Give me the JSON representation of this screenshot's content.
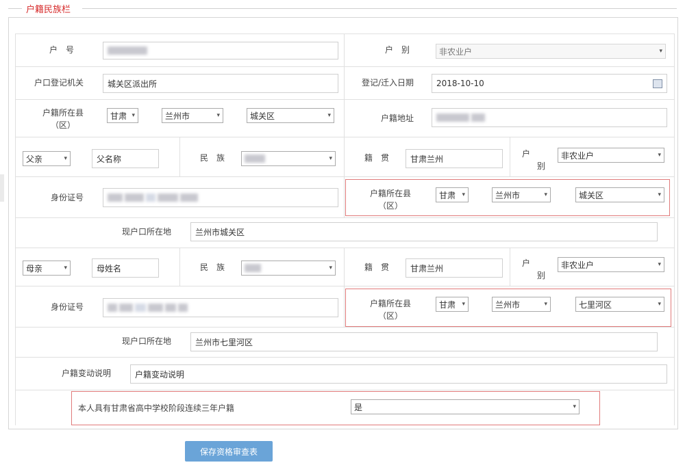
{
  "section": {
    "title": "户籍民族栏"
  },
  "household": {
    "hukou_no_label": "户　号",
    "hukou_no_value": "",
    "hukou_type_label": "户　别",
    "hukou_type_value": "非农业户",
    "reg_office_label": "户口登记机关",
    "reg_office_value": "城关区派出所",
    "reg_date_label": "登记/迁入日期",
    "reg_date_value": "2018-10-10",
    "county_label": "户籍所在县（区）",
    "province": "甘肃",
    "city": "兰州市",
    "district": "城关区",
    "address_label": "户籍地址",
    "address_value": ""
  },
  "father": {
    "relation": "父亲",
    "name_placeholder": "父名称",
    "ethnicity_label": "民　族",
    "ethnicity_value": "",
    "native_label": "籍　贯",
    "native_value": "甘肃兰州",
    "hukou_type_label": "户　别",
    "hukou_type_value": "非农业户",
    "id_label": "身份证号",
    "county_label": "户籍所在县（区）",
    "province": "甘肃",
    "city": "兰州市",
    "district": "城关区",
    "current_label": "现户口所在地",
    "current_value": "兰州市城关区"
  },
  "mother": {
    "relation": "母亲",
    "name_placeholder": "母姓名",
    "ethnicity_label": "民　族",
    "ethnicity_value": "",
    "native_label": "籍　贯",
    "native_value": "甘肃兰州",
    "hukou_type_label": "户　别",
    "hukou_type_value": "非农业户",
    "id_label": "身份证号",
    "county_label": "户籍所在县（区）",
    "province": "甘肃",
    "city": "兰州市",
    "district": "七里河区",
    "current_label": "现户口所在地",
    "current_value": "兰州市七里河区"
  },
  "change": {
    "label": "户籍变动说明",
    "value": "户籍变动说明"
  },
  "highschool": {
    "label": "本人具有甘肃省高中学校阶段连续三年户籍",
    "value": "是"
  },
  "save_button": "保存资格审查表",
  "colors": {
    "accent_red": "#d62a2a",
    "button_blue": "#6aa4d8",
    "highlight_border": "#e07a7a"
  }
}
